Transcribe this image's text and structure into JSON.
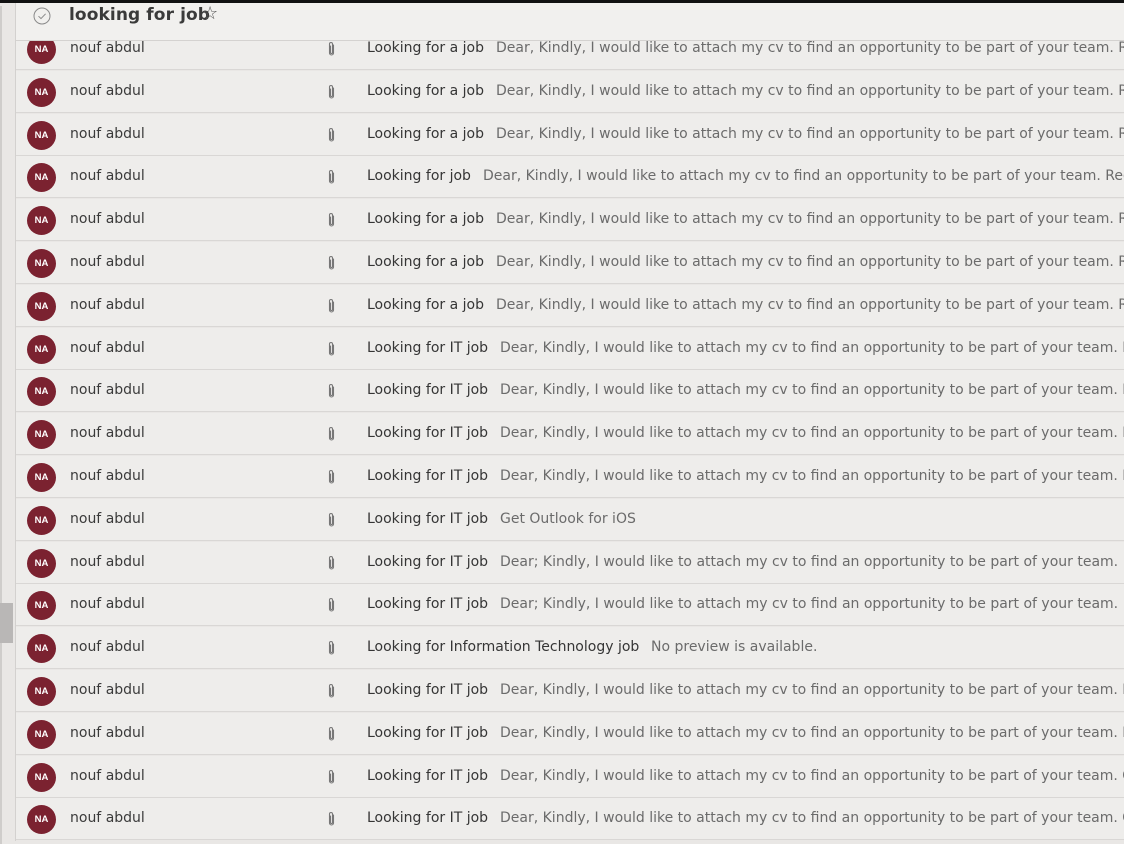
{
  "header": {
    "title": "looking for job",
    "check_icon": "circle-check-icon",
    "star_icon": "star-outline-icon",
    "star_glyph": "☆"
  },
  "colors": {
    "avatar_bg": "#7b2230",
    "background": "#e9e7e5"
  },
  "messages": [
    {
      "initials": "NA",
      "sender": "nouf abdul",
      "subject": "Looking for a job",
      "preview": "Dear, Kindly, I would like to attach my cv to find an opportunity to be part of your team. Regards."
    },
    {
      "initials": "NA",
      "sender": "nouf abdul",
      "subject": "Looking for a job",
      "preview": "Dear, Kindly, I would like to attach my cv to find an opportunity to be part of your team. Regards."
    },
    {
      "initials": "NA",
      "sender": "nouf abdul",
      "subject": "Looking for a job",
      "preview": "Dear, Kindly, I would like to attach my cv to find an opportunity to be part of your team. Regards."
    },
    {
      "initials": "NA",
      "sender": "nouf abdul",
      "subject": "Looking for job",
      "preview": "Dear, Kindly, I would like to attach my cv to find an opportunity to be part of your team. Regards."
    },
    {
      "initials": "NA",
      "sender": "nouf abdul",
      "subject": "Looking for a job",
      "preview": "Dear, Kindly, I would like to attach my cv to find an opportunity to be part of your team. Regards."
    },
    {
      "initials": "NA",
      "sender": "nouf abdul",
      "subject": "Looking for a job",
      "preview": "Dear, Kindly, I would like to attach my cv to find an opportunity to be part of your team. Regards."
    },
    {
      "initials": "NA",
      "sender": "nouf abdul",
      "subject": "Looking for a job",
      "preview": "Dear, Kindly, I would like to attach my cv to find an opportunity to be part of your team. Regards."
    },
    {
      "initials": "NA",
      "sender": "nouf abdul",
      "subject": "Looking for IT job",
      "preview": "Dear, Kindly, I would like to attach my cv to find an opportunity to be part of your team. Regards."
    },
    {
      "initials": "NA",
      "sender": "nouf abdul",
      "subject": "Looking for IT job",
      "preview": "Dear, Kindly, I would like to attach my cv to find an opportunity to be part of your team. Regards."
    },
    {
      "initials": "NA",
      "sender": "nouf abdul",
      "subject": "Looking for IT job",
      "preview": "Dear, Kindly, I would like to attach my cv to find an opportunity to be part of your team. Regards."
    },
    {
      "initials": "NA",
      "sender": "nouf abdul",
      "subject": "Looking for IT job",
      "preview": "Dear, Kindly, I would like to attach my cv to find an opportunity to be part of your team. Regards."
    },
    {
      "initials": "NA",
      "sender": "nouf abdul",
      "subject": "Looking for IT job",
      "preview": "Get Outlook for iOS"
    },
    {
      "initials": "NA",
      "sender": "nouf abdul",
      "subject": "Looking for IT job",
      "preview": "Dear; Kindly, I would like to attach my cv to find an opportunity to be part of your team."
    },
    {
      "initials": "NA",
      "sender": "nouf abdul",
      "subject": "Looking for IT job",
      "preview": "Dear; Kindly, I would like to attach my cv to find an opportunity to be part of your team."
    },
    {
      "initials": "NA",
      "sender": "nouf abdul",
      "subject": "Looking for Information Technology job",
      "preview": "No preview is available."
    },
    {
      "initials": "NA",
      "sender": "nouf abdul",
      "subject": "Looking for IT job",
      "preview": "Dear, Kindly, I would like to attach my cv to find an opportunity to be part of your team. Note that"
    },
    {
      "initials": "NA",
      "sender": "nouf abdul",
      "subject": "Looking for IT job",
      "preview": "Dear, Kindly, I would like to attach my cv to find an opportunity to be part of your team. Note that"
    },
    {
      "initials": "NA",
      "sender": "nouf abdul",
      "subject": "Looking for IT job",
      "preview": "Dear, Kindly, I would like to attach my cv to find an opportunity to be part of your team. Get Outlo"
    },
    {
      "initials": "NA",
      "sender": "nouf abdul",
      "subject": "Looking for IT job",
      "preview": "Dear, Kindly, I would like to attach my cv to find an opportunity to be part of your team. Get Outlo"
    }
  ]
}
